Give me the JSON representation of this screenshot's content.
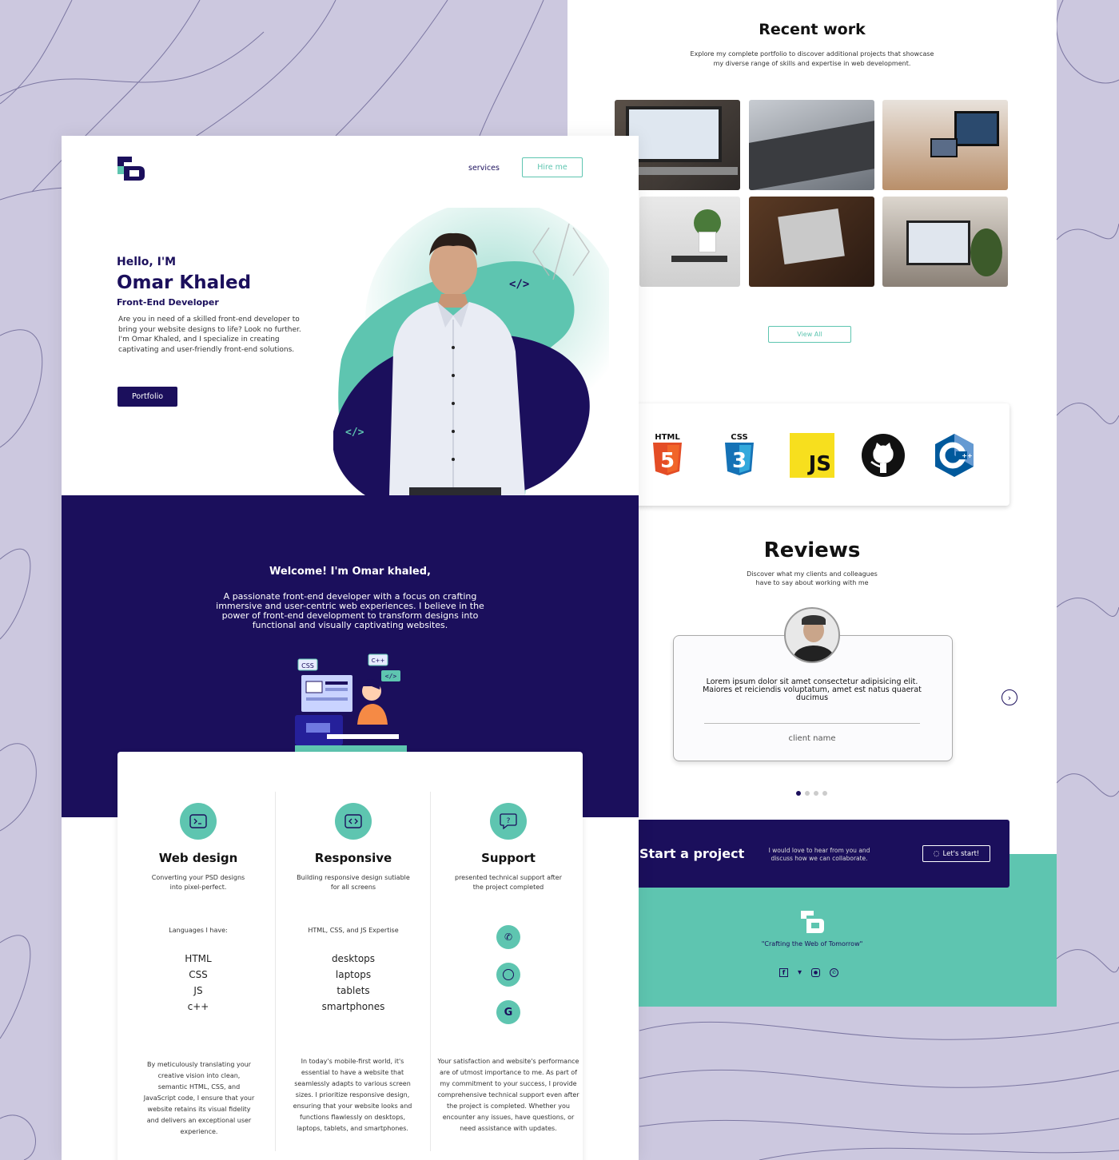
{
  "colors": {
    "navy": "#1b0f5c",
    "teal": "#5ec5b0",
    "bg": "#ccc8df"
  },
  "recent_work": {
    "title": "Recent work",
    "description": "Explore my complete portfolio to discover additional projects that showcase my diverse range of skills and expertise in web development.",
    "view_all": "View All"
  },
  "tech": [
    {
      "label": "HTML",
      "icon": "html5-icon"
    },
    {
      "label": "CSS",
      "icon": "css3-icon"
    },
    {
      "label": "JS",
      "icon": "javascript-icon"
    },
    {
      "label": "",
      "icon": "github-icon"
    },
    {
      "label": "",
      "icon": "cplusplus-icon"
    }
  ],
  "reviews": {
    "title": "Reviews",
    "description": "Discover what my clients and colleagues have to say about working with me",
    "text": "Lorem ipsum dolor sit amet consectetur adipisicing elit. Maiores et reiciendis voluptatum, amet est natus quaerat ducimus",
    "client": "client name"
  },
  "cta": {
    "title": "Start a project",
    "text": "I would love to hear from you and discuss how we can collaborate.",
    "button": "Let's start!"
  },
  "footer": {
    "tagline": "\"Crafting the Web of Tomorrow\""
  },
  "nav": {
    "services": "services",
    "hire": "Hire me"
  },
  "hero": {
    "hello": "Hello, I'M",
    "name": "Omar Khaled",
    "role": "Front-End Developer",
    "description": "Are you in need of a skilled front-end developer to bring your website designs to life? Look no further. I'm Omar Khaled, and I specialize in creating captivating and user-friendly front-end solutions.",
    "button": "Portfolio"
  },
  "welcome": {
    "title": "Welcome! I'm Omar khaled,",
    "text": "A passionate front-end developer with a focus on crafting immersive and user-centric web experiences. I believe in the power of front-end development to transform designs into functional and visually captivating websites."
  },
  "services": [
    {
      "title": "Web design",
      "sub": "Converting your PSD designs into pixel-perfect.",
      "heading": "Languages I have:",
      "items": [
        "HTML",
        "CSS",
        "JS",
        "c++"
      ],
      "para": "By meticulously translating your creative vision into clean, semantic HTML, CSS, and JavaScript code, I ensure that your website retains its visual fidelity and delivers an exceptional user experience."
    },
    {
      "title": "Responsive",
      "sub": "Building responsive design sutiable for all screens",
      "heading": "HTML, CSS, and JS Expertise",
      "items": [
        "desktops",
        "laptops",
        "tablets",
        "smartphones"
      ],
      "para": "In today's mobile-first world, it's essential to have a website that seamlessly adapts to various screen sizes. I prioritize responsive design, ensuring that your website looks and functions flawlessly on desktops, laptops, tablets, and smartphones."
    },
    {
      "title": "Support",
      "sub": "presented technical support after the project completed",
      "heading": "",
      "items": [],
      "para": "Your satisfaction and website's performance are of utmost importance to me. As part of my commitment to your success, I provide comprehensive technical support even after the project is completed. Whether you encounter any issues, have questions, or need assistance with updates."
    }
  ],
  "sprite_labels": {
    "css": "CSS",
    "cpp": "C++"
  }
}
